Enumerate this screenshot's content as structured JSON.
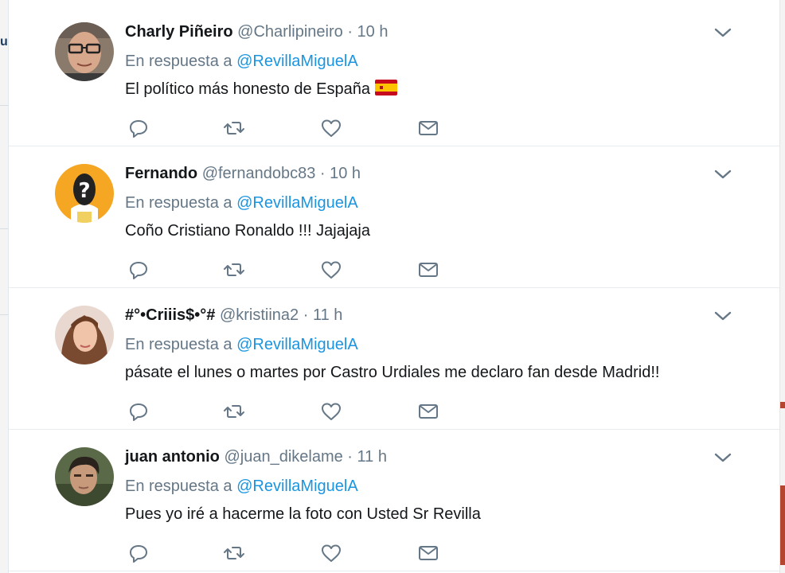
{
  "thread": {
    "reply_prefix": "En respuesta a",
    "tweets": [
      {
        "name": "Charly Piñeiro",
        "handle": "@Charlipineiro",
        "separator": "·",
        "time": "10 h",
        "in_reply_to": "@RevillaMiguelA",
        "text": "El político más honesto de España",
        "emoji": "spain-flag-icon",
        "avatar": "avatar-man-glasses"
      },
      {
        "name": "Fernando",
        "handle": "@fernandobc83",
        "separator": "·",
        "time": "10 h",
        "in_reply_to": "@RevillaMiguelA",
        "text": "Coño Cristiano Ronaldo !!! Jajajaja",
        "avatar": "avatar-question-mark"
      },
      {
        "name": "#°•Criiis$•°#",
        "handle": "@kristiina2",
        "separator": "·",
        "time": "11 h",
        "in_reply_to": "@RevillaMiguelA",
        "text": "pásate el lunes o martes por Castro Urdiales me declaro fan desde Madrid!!",
        "avatar": "avatar-woman"
      },
      {
        "name": "juan antonio",
        "handle": "@juan_dikelame",
        "separator": "·",
        "time": "11 h",
        "in_reply_to": "@RevillaMiguelA",
        "text": "Pues yo iré a hacerme la foto con Usted Sr Revilla",
        "avatar": "avatar-young-man"
      }
    ]
  },
  "icons": [
    "reply-icon",
    "retweet-icon",
    "like-icon",
    "direct-message-icon",
    "chevron-down-icon"
  ],
  "colors": {
    "name": "#14171a",
    "secondary": "#657786",
    "mention": "#1b95e0",
    "action": "#657786",
    "divider": "#e6ecf0"
  }
}
